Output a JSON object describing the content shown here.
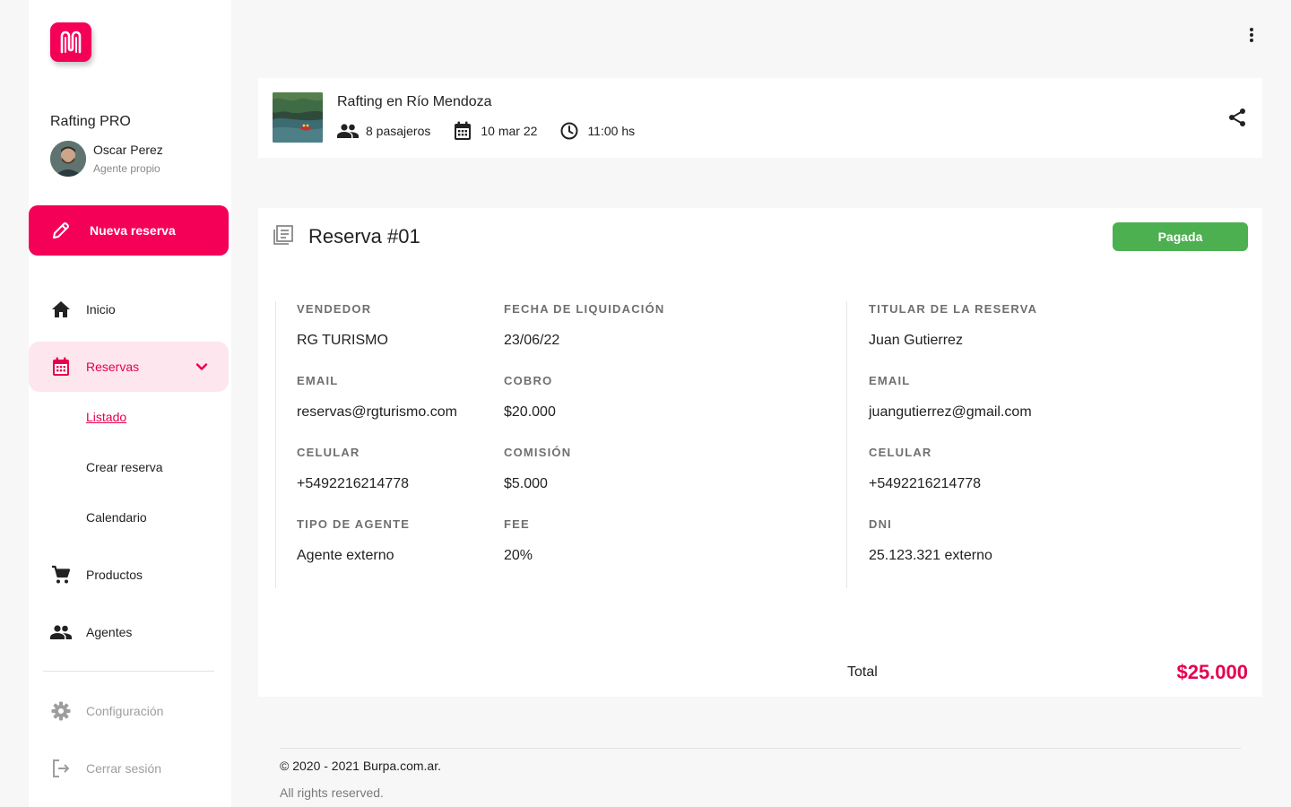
{
  "brand": {
    "name": "Rafting PRO"
  },
  "user": {
    "name": "Oscar Perez",
    "role": "Agente propio"
  },
  "sidebar": {
    "new_button": "Nueva reserva",
    "items": [
      {
        "label": "Inicio",
        "icon": "home-icon"
      },
      {
        "label": "Reservas",
        "icon": "calendar-icon"
      },
      {
        "label": "Productos",
        "icon": "cart-icon"
      },
      {
        "label": "Agentes",
        "icon": "people-icon"
      }
    ],
    "sub_items": [
      {
        "label": "Listado"
      },
      {
        "label": "Crear reserva"
      },
      {
        "label": "Calendario"
      }
    ],
    "bottom_items": [
      {
        "label": "Configuración",
        "icon": "gear-icon"
      },
      {
        "label": "Cerrar sesión",
        "icon": "logout-icon"
      }
    ]
  },
  "product": {
    "title": "Rafting en Río Mendoza",
    "passengers": "8 pasajeros",
    "date": "10 mar 22",
    "time": "11:00 hs"
  },
  "reservation": {
    "title": "Reserva #01",
    "status": "Pagada",
    "status_color": "#4caf50",
    "fields": {
      "vendedor_label": "VENDEDOR",
      "vendedor": "RG TURISMO",
      "email_label": "EMAIL",
      "email": "reservas@rgturismo.com",
      "celular_label": "CELULAR",
      "celular": "+5492216214778",
      "tipo_label": "TIPO DE AGENTE",
      "tipo": "Agente externo",
      "fecha_label": "FECHA DE LIQUIDACIÓN",
      "fecha": "23/06/22",
      "cobro_label": "COBRO",
      "cobro": "$20.000",
      "comision_label": "COMISIÓN",
      "comision": "$5.000",
      "fee_label": "FEE",
      "fee": "20%",
      "titular_label": "TITULAR DE LA RESERVA",
      "titular": "Juan Gutierrez",
      "titular_email_label": "EMAIL",
      "titular_email": "juangutierrez@gmail.com",
      "titular_celular_label": "CELULAR",
      "titular_celular": "+5492216214778",
      "dni_label": "DNI",
      "dni": "25.123.321 externo"
    },
    "total_label": "Total",
    "total": "$25.000"
  },
  "footer": {
    "copyright": "© 2020 - 2021 Burpa.com.ar.",
    "rights": "All rights reserved."
  },
  "colors": {
    "accent": "#f50057",
    "accent_text": "#e6004f",
    "active_bg": "#fde6ee",
    "success": "#4caf50"
  }
}
